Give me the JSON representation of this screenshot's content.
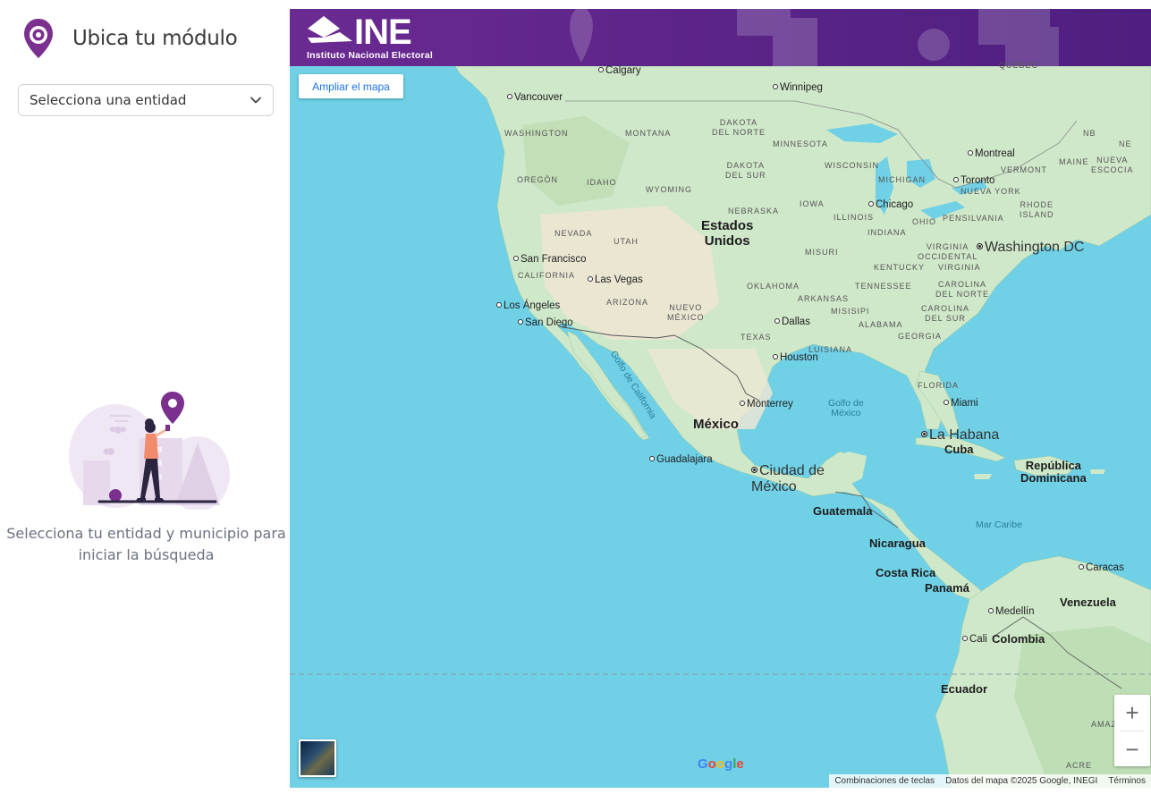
{
  "sidebar": {
    "title": "Ubica tu módulo",
    "select_value": "Selecciona una entidad",
    "hint_line1": "Selecciona tu entidad y municipio para",
    "hint_line2": "iniciar la búsqueda"
  },
  "banner": {
    "logo_text": "INE",
    "logo_subtitle": "Instituto Nacional Electoral"
  },
  "map": {
    "expand_button": "Ampliar el mapa",
    "zoom_in": "+",
    "zoom_out": "−",
    "google_logo": "Google",
    "attribution": {
      "shortcuts": "Combinaciones de teclas",
      "data": "Datos del mapa ©2025 Google, INEGI",
      "terms": "Términos"
    },
    "labels": {
      "calgary": "Calgary",
      "winnipeg": "Winnipeg",
      "quebec": "QUEBEC",
      "vancouver": "Vancouver",
      "washington": "WASHINGTON",
      "montana": "MONTANA",
      "dakota_norte": "DAKOTA\nDEL NORTE",
      "minnesota": "MINNESOTA",
      "montreal": "Montreal",
      "nb": "NB",
      "ne": "NE",
      "oregon": "OREGÓN",
      "idaho": "IDAHO",
      "wyoming": "WYOMING",
      "dakota_sur": "DAKOTA\nDEL SUR",
      "wisconsin": "WISCONSIN",
      "vermont": "VERMONT",
      "maine": "MAINE",
      "nueva_escocia": "NUEVA\nESCOCIA",
      "michigan": "MICHIGAN",
      "toronto": "Toronto",
      "nueva_york": "NUEVA YORK",
      "iowa": "IOWA",
      "nebraska": "NEBRASKA",
      "chicago": "Chicago",
      "rhode_island": "RHODE\nISLAND",
      "estados_unidos": "Estados\nUnidos",
      "illinois": "ILLINOIS",
      "ohio": "OHIO",
      "pensilvania": "PENSILVANIA",
      "nevada": "NEVADA",
      "utah": "UTAH",
      "indiana": "INDIANA",
      "washington_dc": "Washington DC",
      "virginia_occ": "VIRGINIA\nOCCIDENTAL",
      "san_francisco": "San Francisco",
      "misuri": "MISURI",
      "kentucky": "KENTUCKY",
      "virginia": "VIRGINIA",
      "california": "CALIFORNIA",
      "las_vegas": "Las Vegas",
      "oklahoma": "OKLAHOMA",
      "tennessee": "TENNESSEE",
      "carolina_norte": "CAROLINA\nDEL NORTE",
      "arkansas": "ARKANSAS",
      "los_angeles": "Los Ángeles",
      "arizona": "ARIZONA",
      "nuevo_mexico": "NUEVO\nMÉXICO",
      "misisipi": "MISISIPI",
      "carolina_sur": "CAROLINA\nDEL SUR",
      "san_diego": "San Diego",
      "dallas": "Dallas",
      "alabama": "ALABAMA",
      "georgia": "GEORGIA",
      "texas": "TEXAS",
      "luisiana": "LUISIANA",
      "houston": "Houston",
      "golfo_california": "Golfo de California",
      "florida": "FLORIDA",
      "golfo_mexico": "Golfo de\nMéxico",
      "monterrey": "Monterrey",
      "miami": "Miami",
      "mexico": "México",
      "la_habana": "La Habana",
      "cuba": "Cuba",
      "guadalajara": "Guadalajara",
      "ciudad_mexico": "Ciudad de\nMéxico",
      "republica_dominicana": "República\nDominicana",
      "guatemala": "Guatemala",
      "mar_caribe": "Mar Caribe",
      "nicaragua": "Nicaragua",
      "costa_rica": "Costa Rica",
      "caracas": "Caracas",
      "panama": "Panamá",
      "venezuela": "Venezuela",
      "medellin": "Medellín",
      "cali": "Cali",
      "colombia": "Colombia",
      "ecuador": "Ecuador",
      "amaz": "AMAZ",
      "acre": "ACRE"
    }
  }
}
